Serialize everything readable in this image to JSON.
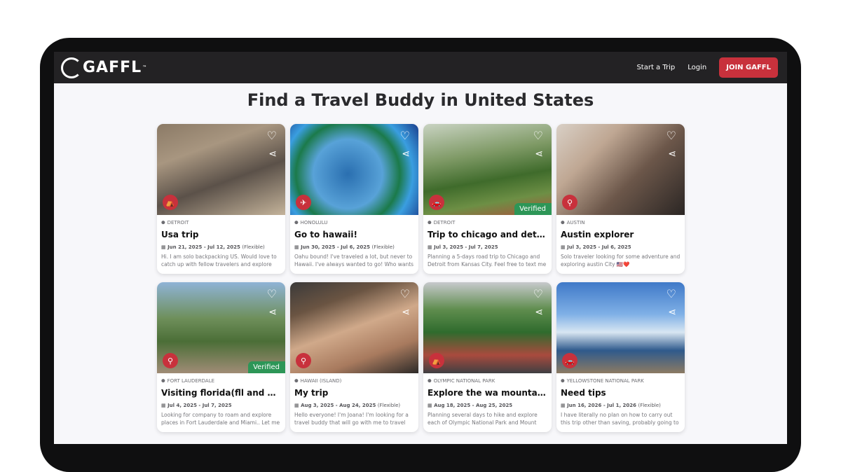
{
  "nav": {
    "logo": "GAFFL",
    "logo_tm": "™",
    "links": [
      "Start a Trip",
      "Login"
    ],
    "join_label": "JOIN GAFFL"
  },
  "page_title": "Find a Travel Buddy in United States",
  "colors": {
    "accent": "#c8313c",
    "verified": "#2d9657",
    "nav_bg": "#232224"
  },
  "cards": [
    {
      "location": "DETROIT",
      "name": "Usa trip",
      "dates": "Jun 21, 2025 - Jul 12, 2025",
      "flex": "(Flexible)",
      "desc": "Hi. I am solo backpacking US. Would love to catch up with fellow travelers and explore cities",
      "verified": "",
      "icon": "hiking-icon"
    },
    {
      "location": "HONOLULU",
      "name": "Go to hawaii!",
      "dates": "Jun 30, 2025 - Jul 6, 2025",
      "flex": "(Flexible)",
      "desc": "Oahu bound! I've traveled a lot, but never to Hawaii. I've always wanted to go! Who wants to",
      "verified": "",
      "icon": "plane-icon"
    },
    {
      "location": "DETROIT",
      "name": "Trip to chicago and detroit!",
      "dates": "Jul 3, 2025 - Jul 7, 2025",
      "flex": "",
      "desc": "Planning a 5-days road trip to Chicago and Detroit from Kansas City. Feel free to text me if",
      "verified": "Verified",
      "icon": "car-icon"
    },
    {
      "location": "AUSTIN",
      "name": "Austin explorer",
      "dates": "Jul 3, 2025 - Jul 6, 2025",
      "flex": "",
      "desc": "Solo traveler looking for some adventure and exploring austin City 🇺🇸❤️",
      "verified": "",
      "icon": "binoculars-icon"
    },
    {
      "location": "FORT LAUDERDALE",
      "name": "Visiting florida(fll and mi...",
      "dates": "Jul 4, 2025 - Jul 7, 2025",
      "flex": "",
      "desc": "Looking for company to roam and explore places in Fort Lauderdale and Miami.. Let me",
      "verified": "Verified",
      "icon": "binoculars-icon"
    },
    {
      "location": "HAWAII (ISLAND)",
      "name": "My trip",
      "dates": "Aug 3, 2025 - Aug 24, 2025",
      "flex": "(Flexible)",
      "desc": "Hello everyone! I'm Joana! I'm looking for a travel buddy that will go with me to travel",
      "verified": "",
      "icon": "binoculars-icon"
    },
    {
      "location": "OLYMPIC NATIONAL PARK",
      "name": "Explore the wa mountain parks",
      "dates": "Aug 18, 2025 - Aug 25, 2025",
      "flex": "",
      "desc": "Planning several days to hike and explore each of Olympic National Park and Mount Rainier",
      "verified": "",
      "icon": "hiking-icon"
    },
    {
      "location": "YELLOWSTONE NATIONAL PARK",
      "name": "Need tips",
      "dates": "Jun 16, 2026 - Jul 1, 2026",
      "flex": "(Flexible)",
      "desc": "I have literally no plan on how to carry out this trip other than saving, probably going to rent ...",
      "verified": "",
      "icon": "car-icon"
    }
  ]
}
